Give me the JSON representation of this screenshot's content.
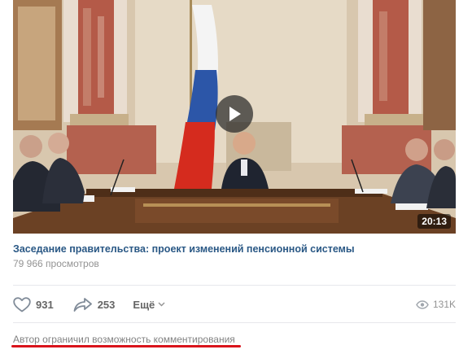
{
  "video": {
    "duration": "20:13",
    "title": "Заседание правительства: проект изменений пенсионной системы",
    "views": "79 966 просмотров"
  },
  "actions": {
    "likes": "931",
    "shares": "253",
    "more_label": "Ещё",
    "view_count": "131K"
  },
  "comments_notice": "Автор ограничил возможность комментирования",
  "colors": {
    "title": "#2a5885",
    "muted": "#939393",
    "underline": "#d9131b"
  },
  "icons": [
    "play-icon",
    "heart-icon",
    "share-arrow-icon",
    "chevron-down-icon",
    "eye-icon"
  ]
}
